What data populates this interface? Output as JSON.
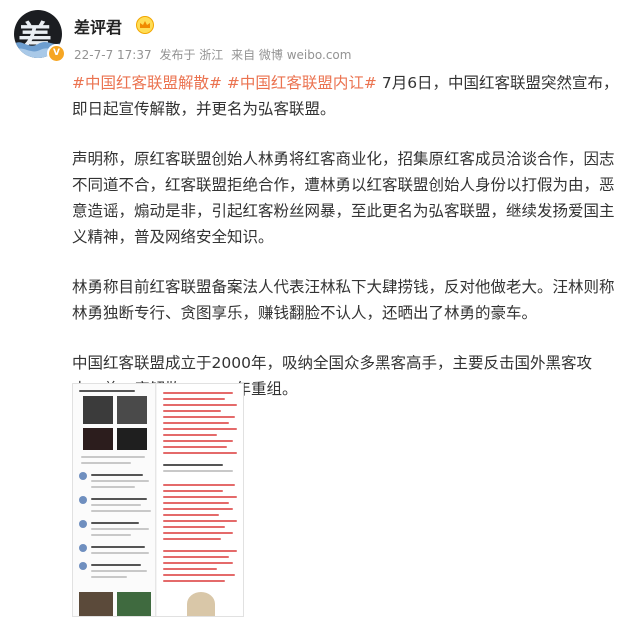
{
  "user": {
    "name": "差评君",
    "avatar_char": "差",
    "verified_badge": "V"
  },
  "meta": {
    "time": "22-7-7 17:37",
    "location": "发布于 浙江",
    "source": "来自 微博 weibo.com"
  },
  "post": {
    "tag1": "#中国红客联盟解散#",
    "tag2": "#中国红客联盟内讧#",
    "p1_text": " 7月6日，中国红客联盟突然宣布，即日起宣传解散，并更名为弘客联盟。",
    "p2": "声明称，原红客联盟创始人林勇将红客商业化，招集原红客成员洽谈合作，因志不同道不合，红客联盟拒绝合作，遭林勇以红客联盟创始人身份以打假为由，恶意造谣，煽动是非，引起红客粉丝网暴，至此更名为弘客联盟，继续发扬爱国主义精神，普及网络安全知识。",
    "p3": "林勇称目前红客联盟备案法人代表汪林私下大肆捞钱，反对他做老大。汪林则称林勇独断专行、贪图享乐，赚钱翻脸不认人，还晒出了林勇的豪车。",
    "p4": "中国红客联盟成立于2000年，吸纳全国众多黑客高手，主要反击国外黑客攻击。曾一度解散，2011年重组。"
  },
  "colors": {
    "tag": "#eb7350",
    "text": "#333333",
    "meta": "#939393"
  },
  "icons": [
    "crown-icon",
    "verified-icon"
  ]
}
